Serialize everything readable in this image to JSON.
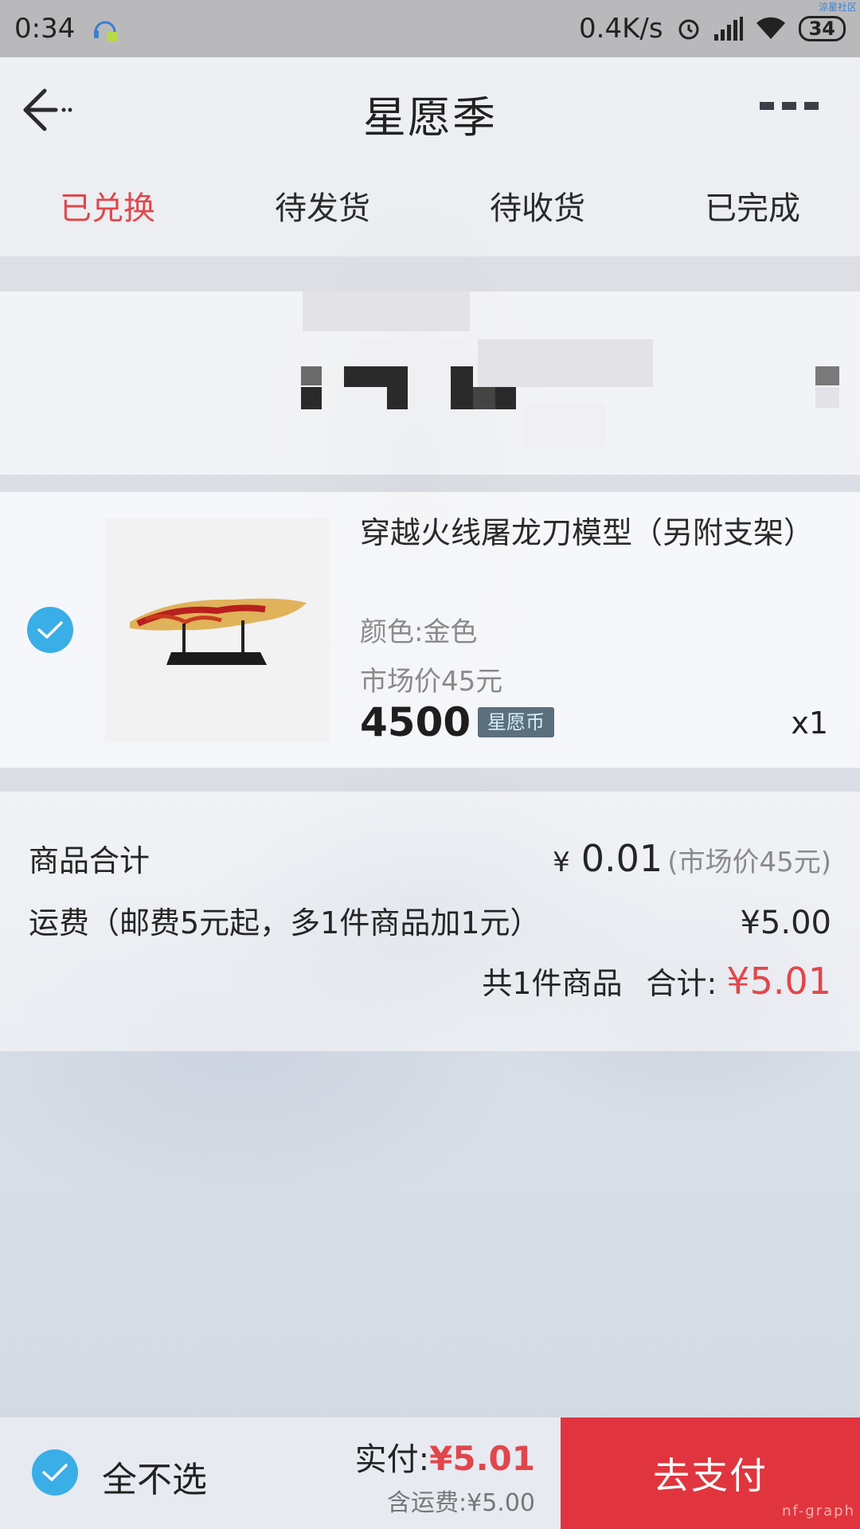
{
  "status_bar": {
    "time": "0:34",
    "network_speed": "0.4K/s",
    "battery": "34",
    "icons": [
      "headset-notification-icon",
      "alarm-icon",
      "signal-icon",
      "wifi-icon",
      "battery-icon"
    ],
    "corner_watermark": "涼星社区"
  },
  "nav": {
    "back_icon": "arrow-left-icon",
    "title": "星愿季",
    "more_icon": "more-dots-icon"
  },
  "tabs": [
    {
      "label": "已兑换",
      "active": true
    },
    {
      "label": "待发货",
      "active": false
    },
    {
      "label": "待收货",
      "active": false
    },
    {
      "label": "已完成",
      "active": false
    }
  ],
  "product": {
    "checked": true,
    "image_icon": "dragon-knife-model-image",
    "name": "穿越火线屠龙刀模型（另附支架）",
    "color": "颜色:金色",
    "market_price": "市场价45元",
    "price": "4500",
    "currency_badge": "星愿币",
    "quantity": "x1"
  },
  "summary": {
    "goods_label": "商品合计",
    "goods_yen": "¥",
    "goods_value": "0.01",
    "goods_market": "(市场价45元)",
    "shipping_label": "运费（邮费5元起，多1件商品加1元）",
    "shipping_value": "¥5.00",
    "count_text": "共1件商品",
    "total_label": "合计:",
    "total_value": "¥5.01"
  },
  "bottom_bar": {
    "select_all_label": "全不选",
    "pay_label": "实付:",
    "pay_value": "¥5.01",
    "pay_shipping": "含运费:¥5.00",
    "pay_button": "去支付",
    "watermark": "nf-graph"
  },
  "colors": {
    "accent_red": "#e0474c",
    "pay_button": "#e0353e",
    "check_blue": "#3aaee6",
    "badge_bg": "#5c6f7c"
  }
}
